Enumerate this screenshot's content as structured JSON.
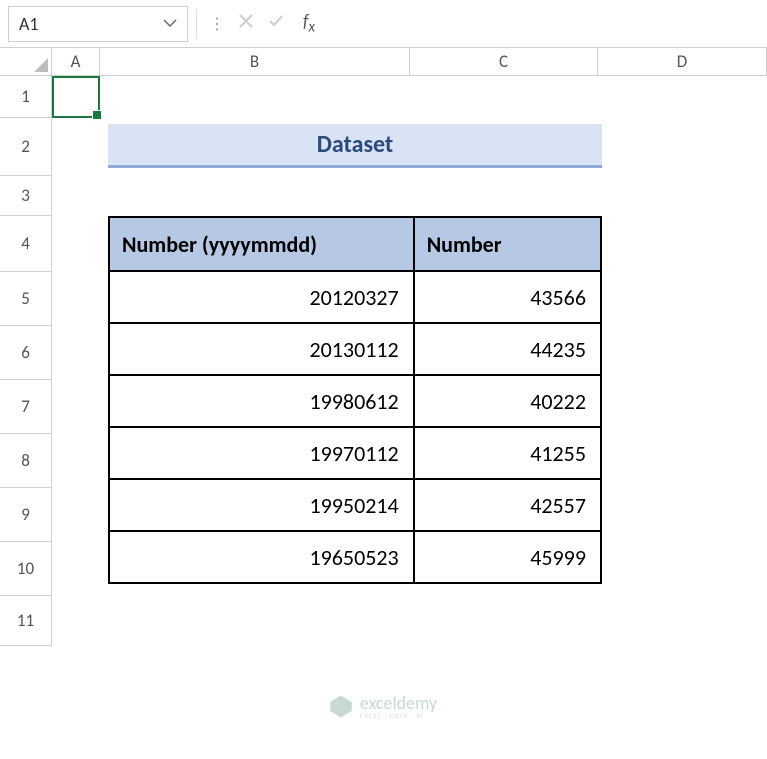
{
  "nameBox": {
    "value": "A1"
  },
  "formulaBar": {
    "value": ""
  },
  "columns": [
    "A",
    "B",
    "C",
    "D"
  ],
  "rows": [
    "1",
    "2",
    "3",
    "4",
    "5",
    "6",
    "7",
    "8",
    "9",
    "10",
    "11"
  ],
  "title": "Dataset",
  "table": {
    "headers": [
      "Number (yyyymmdd)",
      "Number"
    ],
    "rows": [
      [
        "20120327",
        "43566"
      ],
      [
        "20130112",
        "44235"
      ],
      [
        "19980612",
        "40222"
      ],
      [
        "19970112",
        "41255"
      ],
      [
        "19950214",
        "42557"
      ],
      [
        "19650523",
        "45999"
      ]
    ]
  },
  "watermark": {
    "name": "exceldemy",
    "sub": "EXCEL · DATA · BI"
  }
}
